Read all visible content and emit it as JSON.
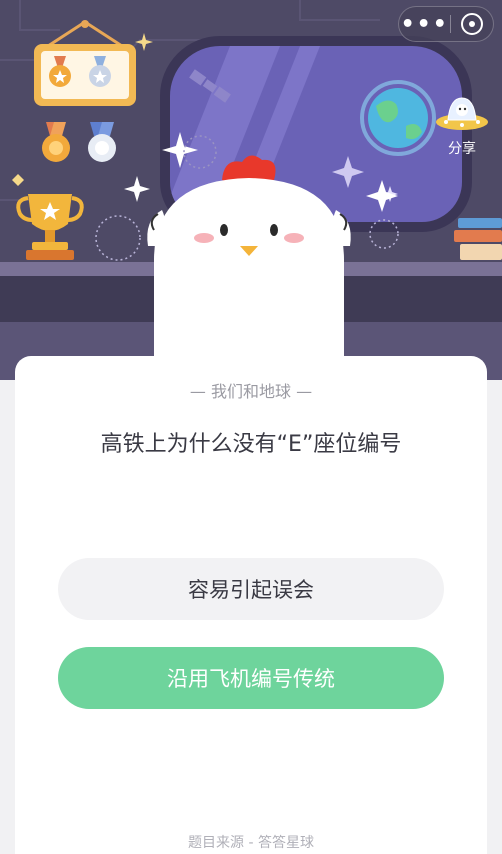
{
  "header": {
    "more_label": "•••",
    "share_label": "分享"
  },
  "quiz": {
    "category": "— 我们和地球 —",
    "question": "高铁上为什么没有“E”座位编号",
    "options": [
      {
        "label": "容易引起误会",
        "state": "default"
      },
      {
        "label": "沿用飞机编号传统",
        "state": "correct"
      }
    ],
    "source": "题目来源 - 答答星球"
  },
  "colors": {
    "scene_bg": "#4e4a66",
    "correct_green": "#6ed49c",
    "option_gray": "#f2f2f4"
  }
}
